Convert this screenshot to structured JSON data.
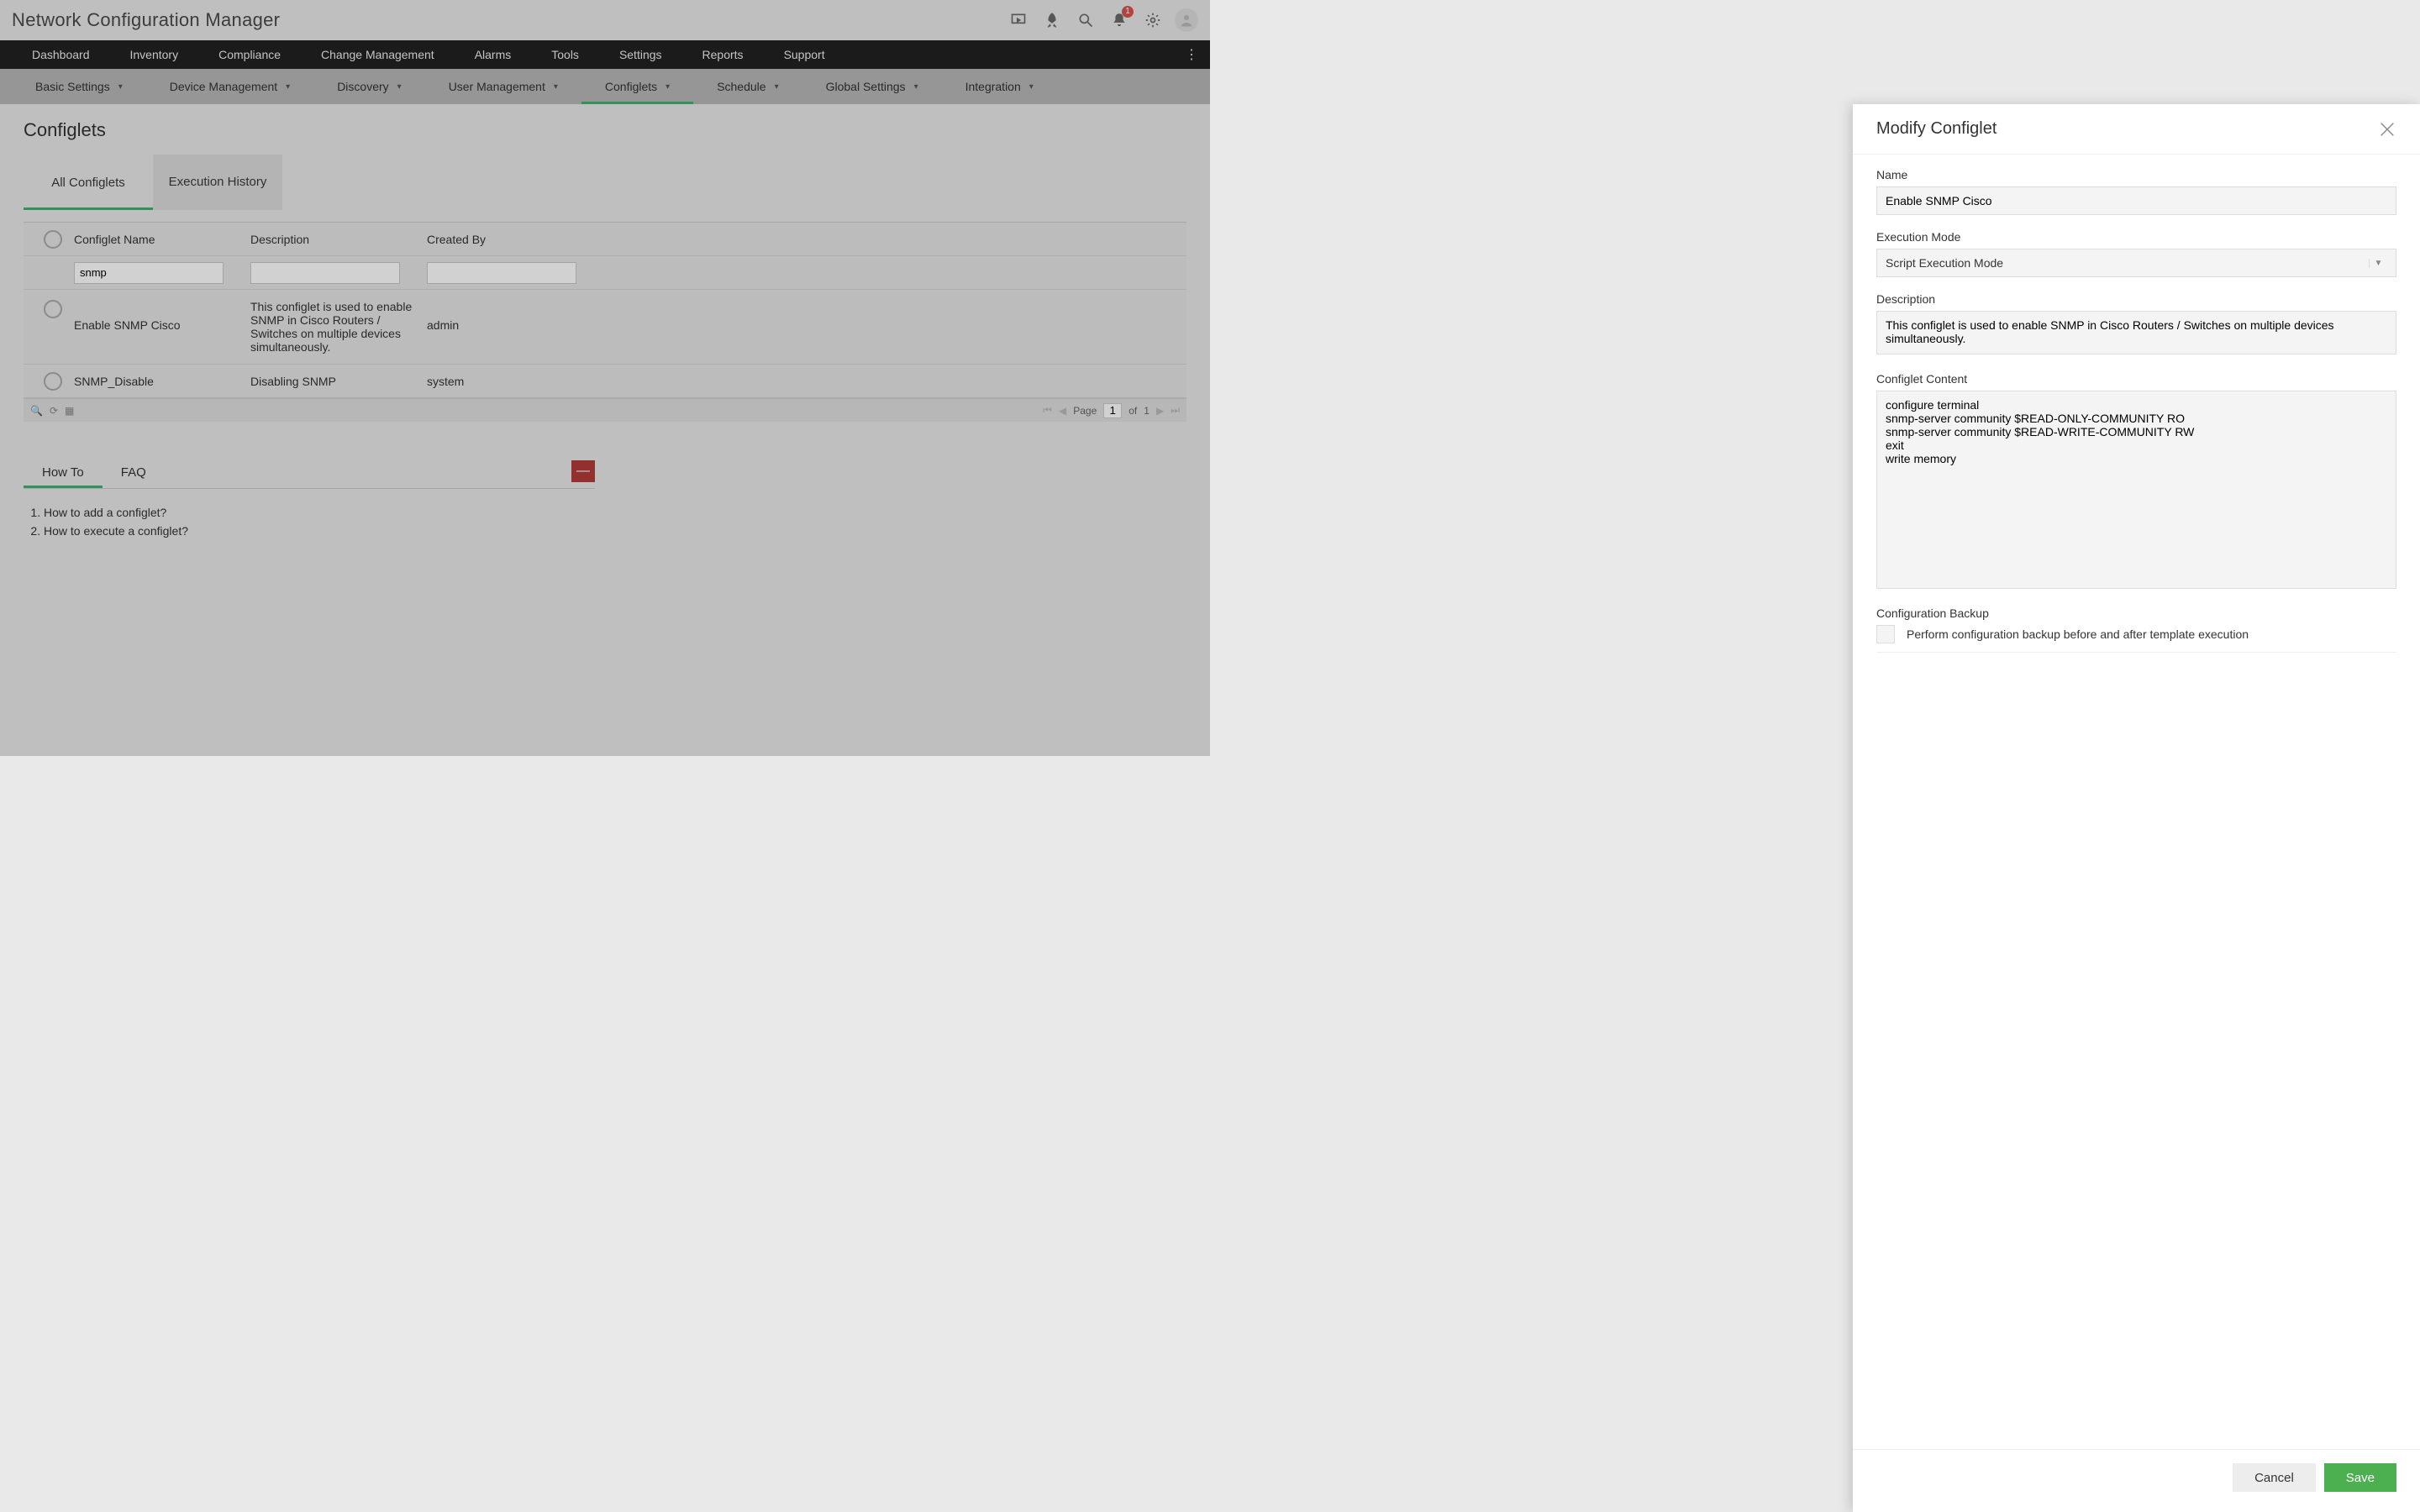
{
  "app": {
    "title": "Network Configuration Manager"
  },
  "header_icons": {
    "notification_count": "1"
  },
  "nav": {
    "primary": [
      "Dashboard",
      "Inventory",
      "Compliance",
      "Change Management",
      "Alarms",
      "Tools",
      "Settings",
      "Reports",
      "Support"
    ],
    "primary_active": 6,
    "sub": [
      "Basic Settings",
      "Device Management",
      "Discovery",
      "User Management",
      "Configlets",
      "Schedule",
      "Global Settings",
      "Integration"
    ],
    "sub_active": 4
  },
  "page": {
    "title": "Configlets",
    "tabs": [
      "All Configlets",
      "Execution History"
    ],
    "tab_active": 0,
    "columns": [
      "Configlet Name",
      "Description",
      "Created By"
    ],
    "filter": {
      "name": "snmp",
      "desc": "",
      "by": ""
    },
    "rows": [
      {
        "name": "Enable SNMP Cisco",
        "desc": "This configlet is used to enable SNMP in Cisco Routers / Switches on multiple devices simultaneously.",
        "by": "admin"
      },
      {
        "name": "SNMP_Disable",
        "desc": "Disabling SNMP",
        "by": "system"
      }
    ],
    "pager": {
      "label": "Page",
      "current": "1",
      "of_label": "of",
      "total": "1"
    }
  },
  "help": {
    "tabs": [
      "How To",
      "FAQ"
    ],
    "active": 0,
    "items": [
      "How to add a configlet?",
      "How to execute a configlet?"
    ]
  },
  "panel": {
    "title": "Modify Configlet",
    "labels": {
      "name": "Name",
      "exec_mode": "Execution Mode",
      "description": "Description",
      "content": "Configlet Content",
      "backup_section": "Configuration Backup",
      "backup_check": "Perform configuration backup before and after template execution"
    },
    "values": {
      "name": "Enable SNMP Cisco",
      "exec_mode": "Script Execution Mode",
      "description": "This configlet is used to enable SNMP in Cisco Routers / Switches on multiple devices simultaneously.",
      "content": "configure terminal\nsnmp-server community $READ-ONLY-COMMUNITY RO\nsnmp-server community $READ-WRITE-COMMUNITY RW\nexit\nwrite memory"
    },
    "buttons": {
      "cancel": "Cancel",
      "save": "Save"
    }
  }
}
